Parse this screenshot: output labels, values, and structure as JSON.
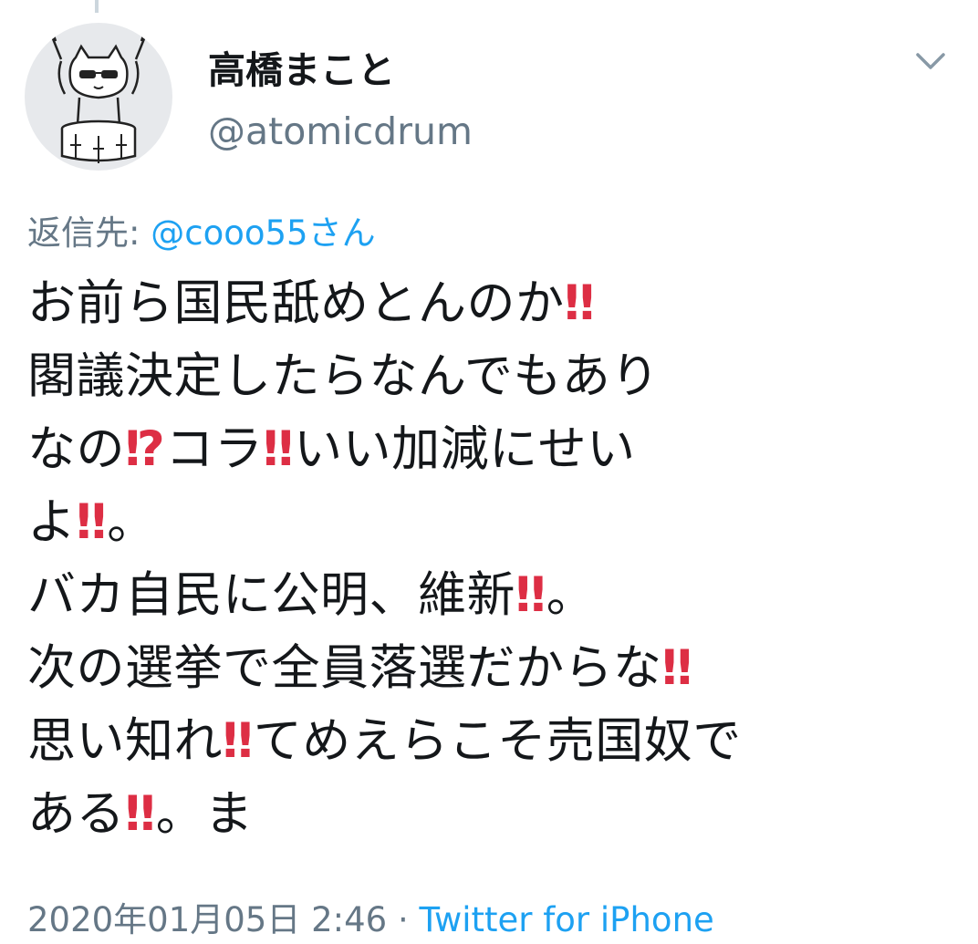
{
  "tweet": {
    "author": {
      "display_name": "高橋まこと",
      "handle": "@atomicdrum",
      "avatar_icon": "cat-drummer-avatar"
    },
    "reply": {
      "prefix": "返信先: ",
      "mention": "@cooo55さん"
    },
    "lines": [
      [
        {
          "t": "お前ら国民舐めとんのか"
        },
        {
          "e": "‼"
        }
      ],
      [
        {
          "t": "閣議決定したらなんでもあり"
        }
      ],
      [
        {
          "t": "なの"
        },
        {
          "e": "⁉"
        },
        {
          "t": "コラ"
        },
        {
          "e": "‼"
        },
        {
          "t": "いい加減にせい"
        }
      ],
      [
        {
          "t": "よ"
        },
        {
          "e": "‼"
        },
        {
          "t": "。"
        }
      ],
      [
        {
          "t": "バカ自民に公明、維新"
        },
        {
          "e": "‼"
        },
        {
          "t": "。"
        }
      ],
      [
        {
          "t": "次の選挙で全員落選だからな"
        },
        {
          "e": "‼"
        }
      ],
      [
        {
          "t": "思い知れ"
        },
        {
          "e": "‼"
        },
        {
          "t": "てめえらこそ売国奴で"
        }
      ],
      [
        {
          "t": "ある"
        },
        {
          "e": "‼"
        },
        {
          "t": "。ま"
        }
      ]
    ],
    "timestamp": "2020年01月05日 2:46",
    "separator": " · ",
    "source": "Twitter for iPhone"
  },
  "colors": {
    "accent": "#1da1f2",
    "secondary_text": "#657786",
    "primary_text": "#14171a",
    "emoji_red": "#dd2e44"
  },
  "icons": {
    "caret": "chevron-down-icon",
    "avatar": "cat-drummer-avatar"
  }
}
